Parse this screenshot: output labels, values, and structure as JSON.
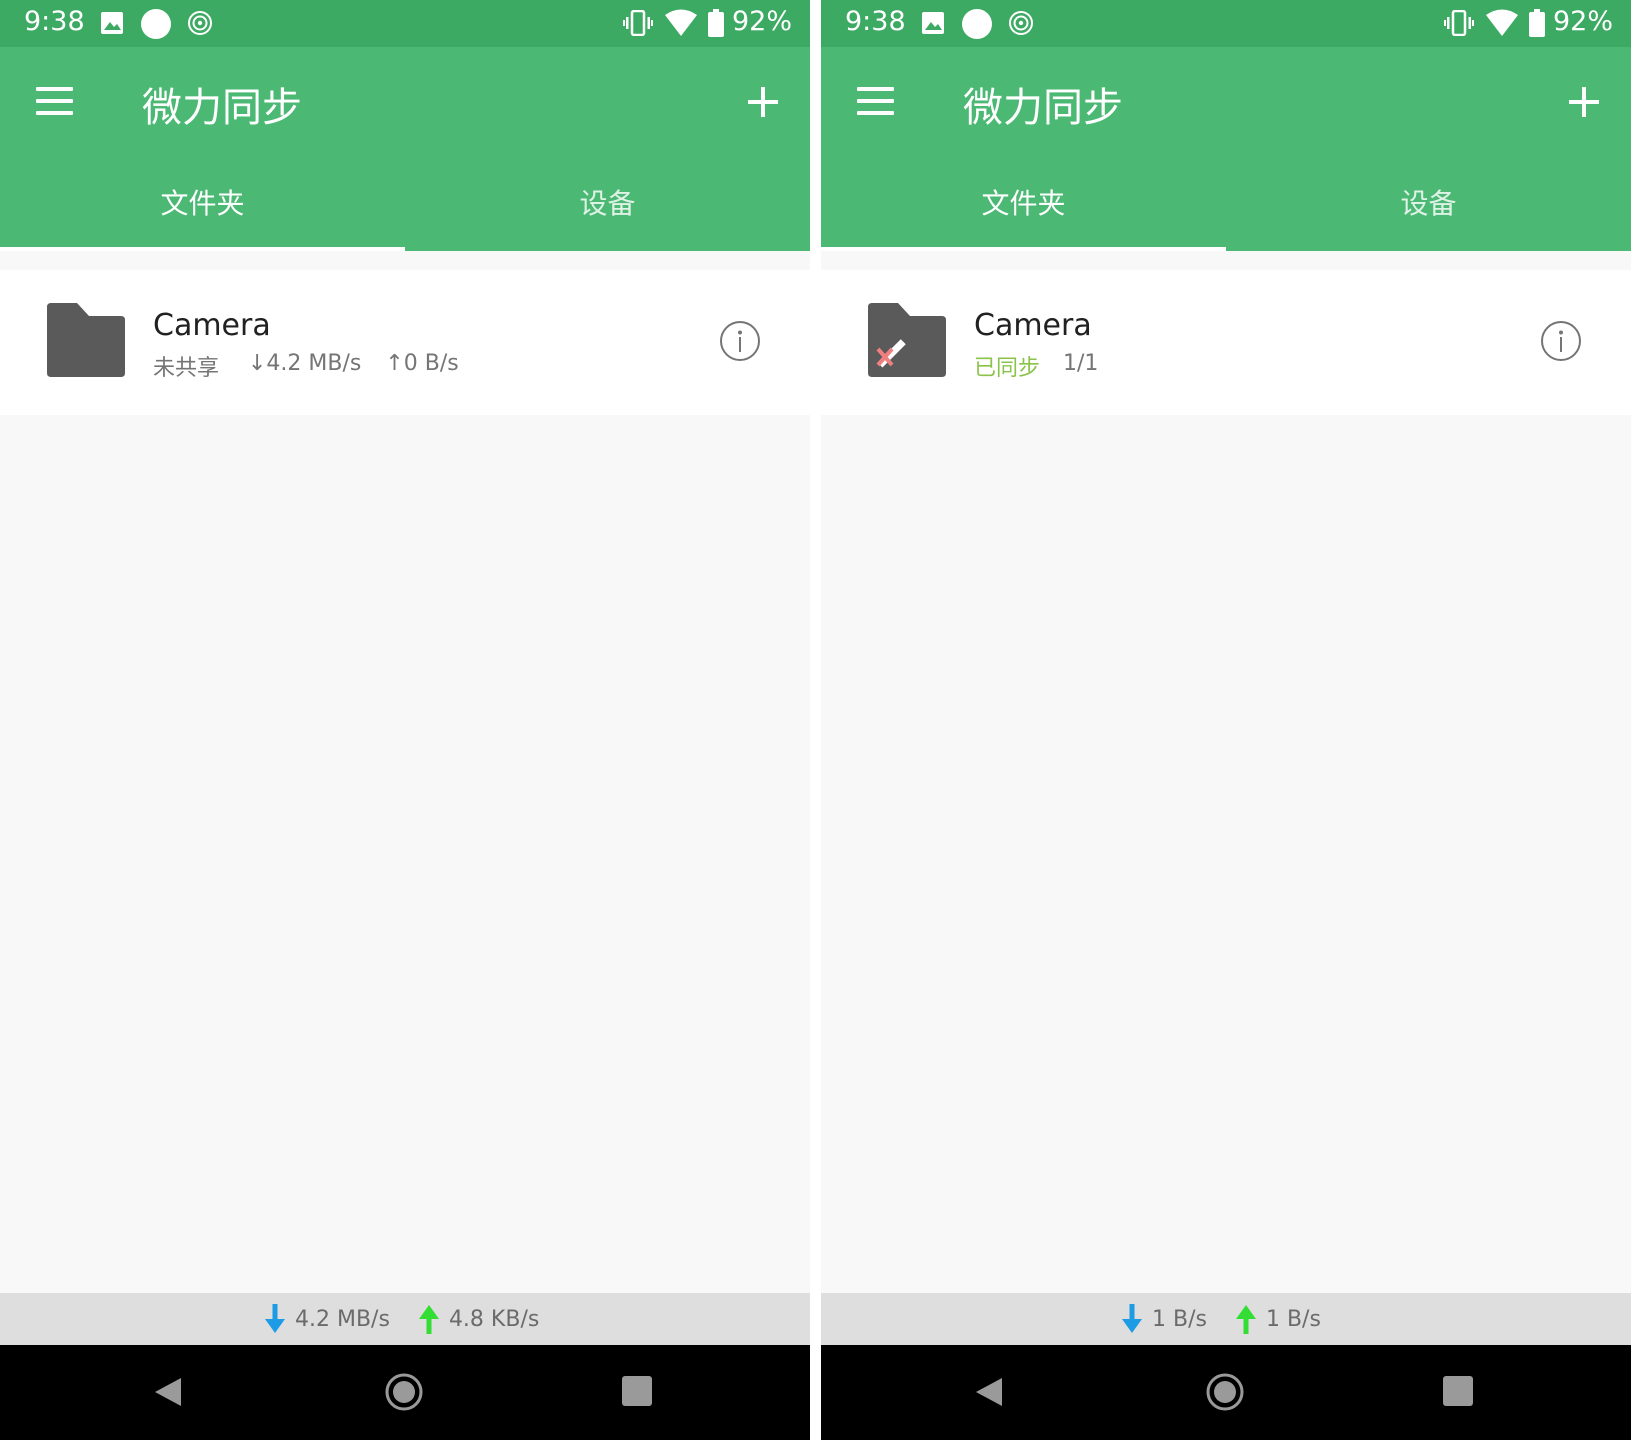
{
  "colors": {
    "status_bar": "#3daa64",
    "app_bar": "#4bb874",
    "synced_text": "#8bc34a",
    "download_arrow": "#1e9be5",
    "upload_arrow": "#33dd33"
  },
  "screens": [
    {
      "status_bar": {
        "time": "9:38",
        "battery": "92%",
        "icons": [
          "image-icon",
          "circle-icon",
          "swirl-icon",
          "vibrate-icon",
          "wifi-icon",
          "battery-icon"
        ]
      },
      "app_bar": {
        "title": "微力同步",
        "menu_icon": "menu-icon",
        "add_icon": "plus-icon"
      },
      "tabs": [
        {
          "label": "文件夹",
          "selected": true
        },
        {
          "label": "设备",
          "selected": false
        }
      ],
      "folders": [
        {
          "name": "Camera",
          "status": "未共享",
          "download_rate": "↓4.2 MB/s",
          "upload_rate": "↑0 B/s",
          "icon": "folder-icon",
          "info_icon": "info-icon"
        }
      ],
      "bottom_status": {
        "download": "4.2 MB/s",
        "upload": "4.8 KB/s"
      }
    },
    {
      "status_bar": {
        "time": "9:38",
        "battery": "92%",
        "icons": [
          "image-icon",
          "circle-icon",
          "swirl-icon",
          "vibrate-icon",
          "wifi-icon",
          "battery-icon"
        ]
      },
      "app_bar": {
        "title": "微力同步",
        "menu_icon": "menu-icon",
        "add_icon": "plus-icon"
      },
      "tabs": [
        {
          "label": "文件夹",
          "selected": true
        },
        {
          "label": "设备",
          "selected": false
        }
      ],
      "folders": [
        {
          "name": "Camera",
          "status": "已同步",
          "progress": "1/1",
          "icon": "folder-edit-icon",
          "info_icon": "info-icon"
        }
      ],
      "bottom_status": {
        "download": "1 B/s",
        "upload": "1 B/s"
      }
    }
  ]
}
